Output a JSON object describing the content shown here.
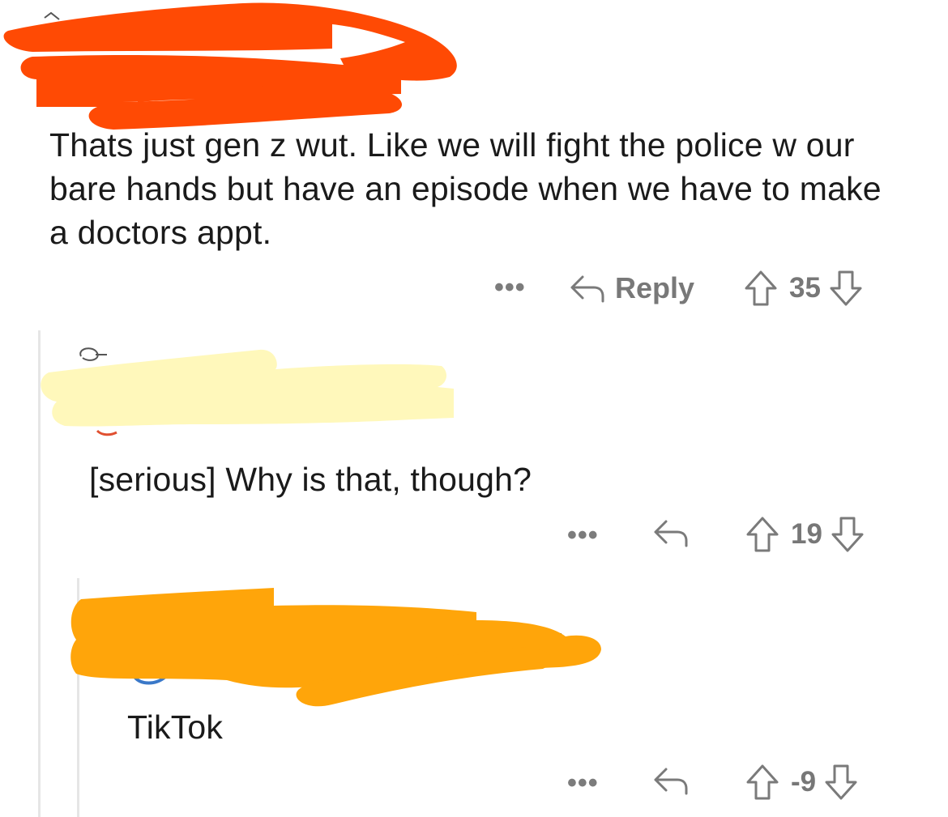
{
  "colors": {
    "redact_red": "#ff4a04",
    "redact_yellow": "#fff8bb",
    "redact_orange": "#ffa50a",
    "icon_gray": "#7a7a7a",
    "thread_line": "#e6e6e6"
  },
  "comments": [
    {
      "body": "Thats just gen z wut. Like we will fight the police w our bare hands but have an episode when we have to make a doctors appt.",
      "more": "•••",
      "reply_label": "Reply",
      "score": "35"
    },
    {
      "body": "[serious] Why is that, though?",
      "more": "•••",
      "reply_label": "",
      "score": "19"
    },
    {
      "body": "TikTok",
      "more": "•••",
      "reply_label": "",
      "score": "-9"
    }
  ]
}
